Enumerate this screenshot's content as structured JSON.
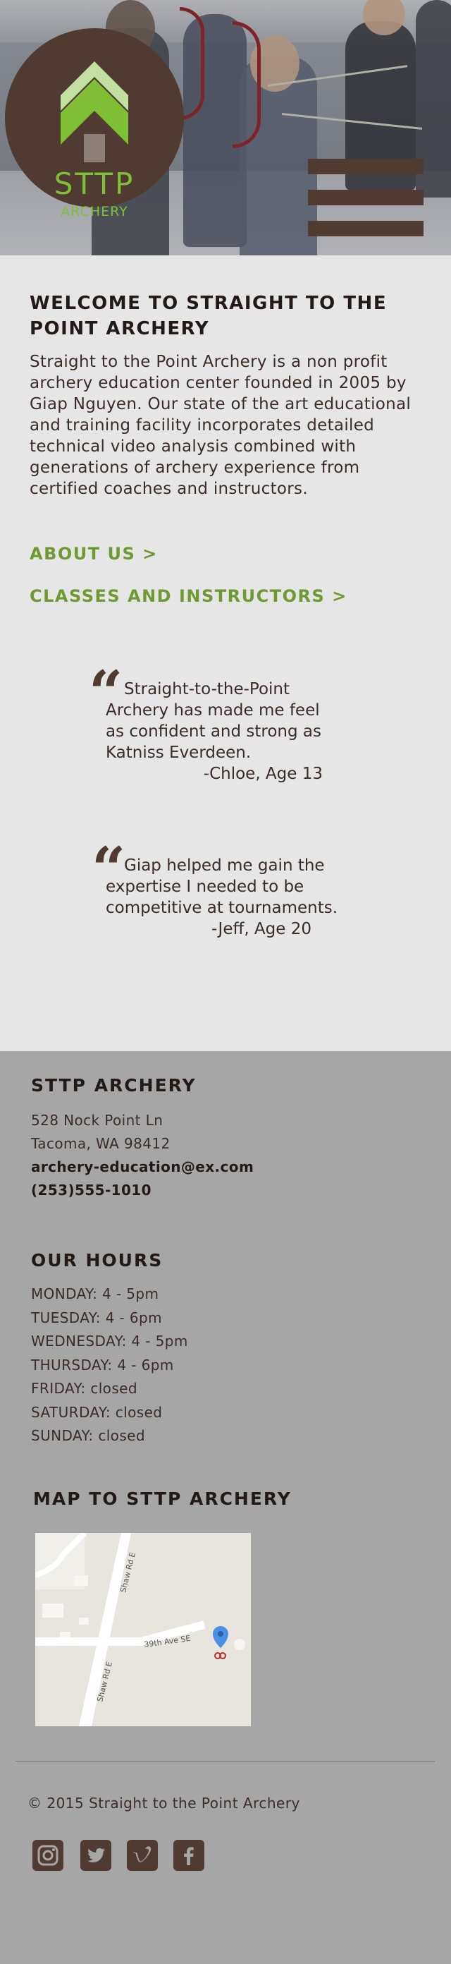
{
  "header": {
    "logo_title": "STTP",
    "logo_subtitle": "ARCHERY",
    "menu_icon": "hamburger-menu-icon"
  },
  "welcome": {
    "title": "WELCOME TO STRAIGHT TO THE POINT ARCHERY",
    "body": "Straight to the Point Archery is a non profit archery education center founded in 2005 by Giap Nguyen. Our state of the art educational and training facility incorporates detailed technical video analysis combined with generations of archery experience from certified coaches and instructors.",
    "links": [
      {
        "label": "ABOUT US >"
      },
      {
        "label": "CLASSES AND INSTRUCTORS >"
      }
    ]
  },
  "testimonials": [
    {
      "text": "Straight-to-the-Point Archery has made me feel as confident and strong as Katniss Everdeen.",
      "author": "-Chloe, Age 13"
    },
    {
      "text": "Giap helped me gain the expertise I needed to be competitive at tournaments.",
      "author": "-Jeff, Age 20"
    }
  ],
  "contact": {
    "title": "STTP ARCHERY",
    "address_line1": "528 Nock Point Ln",
    "address_line2": "Tacoma, WA 98412",
    "email": "archery-education@ex.com",
    "phone": "(253)555-1010"
  },
  "hours": {
    "title": "OUR HOURS",
    "days": [
      "MONDAY: 4 - 5pm",
      "TUESDAY: 4 - 6pm",
      "WEDNESDAY: 4 - 5pm",
      "THURSDAY: 4 - 6pm",
      "FRIDAY: closed",
      "SATURDAY: closed",
      "SUNDAY: closed"
    ]
  },
  "map": {
    "title": "MAP TO STTP ARCHERY",
    "road_labels": [
      "Shaw Rd E",
      "39th Ave SE",
      "Shaw Rd E"
    ]
  },
  "footer": {
    "copyright": "© 2015 Straight to the Point Archery",
    "social_icons": [
      "instagram-icon",
      "twitter-icon",
      "vimeo-icon",
      "facebook-icon"
    ]
  },
  "colors": {
    "brand_brown": "#4f3b31",
    "brand_green": "#7fbf35",
    "link_green": "#6f9a32",
    "main_bg": "#e6e6e6",
    "footer_bg": "#a6a6a6"
  }
}
